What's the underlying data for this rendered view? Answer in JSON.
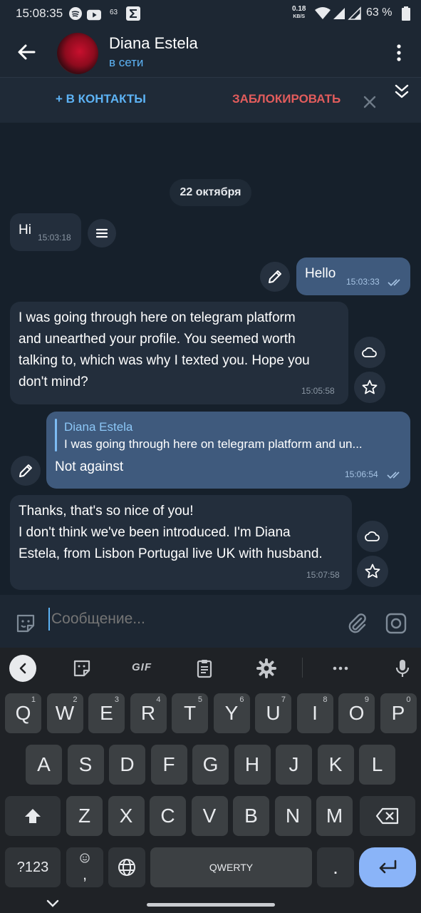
{
  "status_bar": {
    "time": "15:08:35",
    "notif_count": "63",
    "net_speed": "0.18",
    "net_unit": "KB/S",
    "battery": "63 %"
  },
  "header": {
    "contact_name": "Diana Estela",
    "contact_status": "в сети"
  },
  "action_bar": {
    "add_contact": "+ В КОНТАКТЫ",
    "block": "ЗАБЛОКИРОВАТЬ"
  },
  "chat": {
    "date": "22 октября",
    "messages": [
      {
        "direction": "in",
        "text": "Hi",
        "time": "15:03:18"
      },
      {
        "direction": "out",
        "text": "Hello",
        "time": "15:03:33"
      },
      {
        "direction": "in",
        "lines": [
          "I was going through here on telegram platform",
          "and unearthed your profile. You seemed worth",
          "talking to, which was why I texted you. Hope you",
          "don't mind?"
        ],
        "time": "15:05:58"
      },
      {
        "direction": "out",
        "reply_name": "Diana Estela",
        "reply_text": "I was going through here on telegram platform and un...",
        "text": "Not against",
        "time": "15:06:54"
      },
      {
        "direction": "in",
        "lines": [
          "Thanks, that's so nice of you!",
          "I don't think we've been introduced. I'm Diana",
          "Estela, from Lisbon Portugal live UK with husband."
        ],
        "time": "15:07:58"
      }
    ]
  },
  "composer": {
    "placeholder": "Сообщение..."
  },
  "keyboard": {
    "gif_label": "GIF",
    "row1": [
      {
        "k": "Q",
        "n": "1"
      },
      {
        "k": "W",
        "n": "2"
      },
      {
        "k": "E",
        "n": "3"
      },
      {
        "k": "R",
        "n": "4"
      },
      {
        "k": "T",
        "n": "5"
      },
      {
        "k": "Y",
        "n": "6"
      },
      {
        "k": "U",
        "n": "7"
      },
      {
        "k": "I",
        "n": "8"
      },
      {
        "k": "O",
        "n": "9"
      },
      {
        "k": "P",
        "n": "0"
      }
    ],
    "row2": [
      "A",
      "S",
      "D",
      "F",
      "G",
      "H",
      "J",
      "K",
      "L"
    ],
    "row3": [
      "Z",
      "X",
      "C",
      "V",
      "B",
      "N",
      "M"
    ],
    "symbols_key": "?123",
    "comma_key": ",",
    "space_label": "QWERTY",
    "period_key": "."
  },
  "colors": {
    "accent": "#5db3f5",
    "danger": "#e25c5c",
    "bubble_in": "#232e3c",
    "bubble_out": "#3f5a7d",
    "enter_key": "#8ab4f8"
  }
}
